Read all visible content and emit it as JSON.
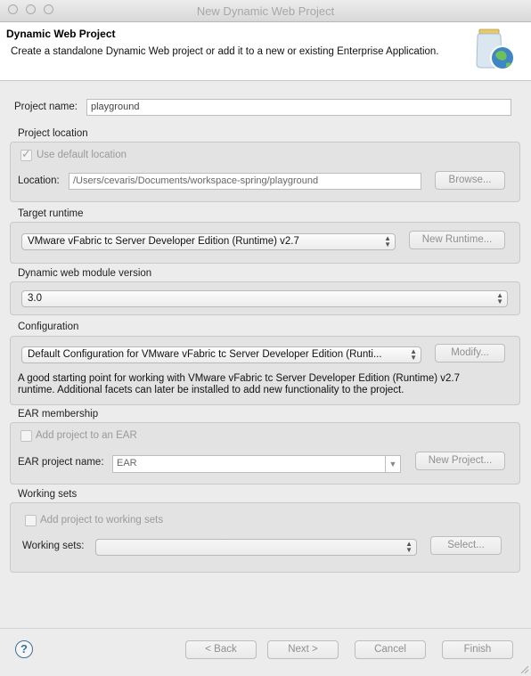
{
  "window": {
    "title": "New Dynamic Web Project"
  },
  "banner": {
    "title": "Dynamic Web Project",
    "description": "Create a standalone Dynamic Web project or add it to a new or existing Enterprise Application.",
    "icon": "web-project-jar-globe-icon"
  },
  "project": {
    "name_label": "Project name:",
    "name_value": "playground"
  },
  "location": {
    "group_label": "Project location",
    "use_default_label": "Use default location",
    "use_default_checked": true,
    "location_label": "Location:",
    "location_value": "/Users/cevaris/Documents/workspace-spring/playground",
    "browse_label": "Browse..."
  },
  "runtime": {
    "group_label": "Target runtime",
    "selected": "VMware vFabric tc Server Developer Edition (Runtime) v2.7",
    "new_label": "New Runtime..."
  },
  "module": {
    "group_label": "Dynamic web module version",
    "selected": "3.0"
  },
  "configuration": {
    "group_label": "Configuration",
    "selected": "Default Configuration for VMware vFabric tc Server Developer Edition (Runti...",
    "modify_label": "Modify...",
    "description_line1": "A good starting point for working with VMware vFabric tc Server Developer Edition (Runtime) v2.7",
    "description_line2": "runtime. Additional facets can later be installed to add new functionality to the project."
  },
  "ear": {
    "group_label": "EAR membership",
    "add_label": "Add project to an EAR",
    "add_checked": false,
    "name_label": "EAR project name:",
    "name_value": "EAR",
    "new_project_label": "New Project..."
  },
  "working_sets": {
    "group_label": "Working sets",
    "add_label": "Add project to working sets",
    "add_checked": false,
    "sets_label": "Working sets:",
    "sets_value": "",
    "select_label": "Select..."
  },
  "footer": {
    "help_icon": "help-icon",
    "back_label": "< Back",
    "next_label": "Next >",
    "cancel_label": "Cancel",
    "finish_label": "Finish"
  },
  "colors": {
    "banner_bg": "#ffffff",
    "dialog_bg": "#ececec",
    "group_bg": "#e3e3e3",
    "help_blue": "#3c6f9c"
  }
}
